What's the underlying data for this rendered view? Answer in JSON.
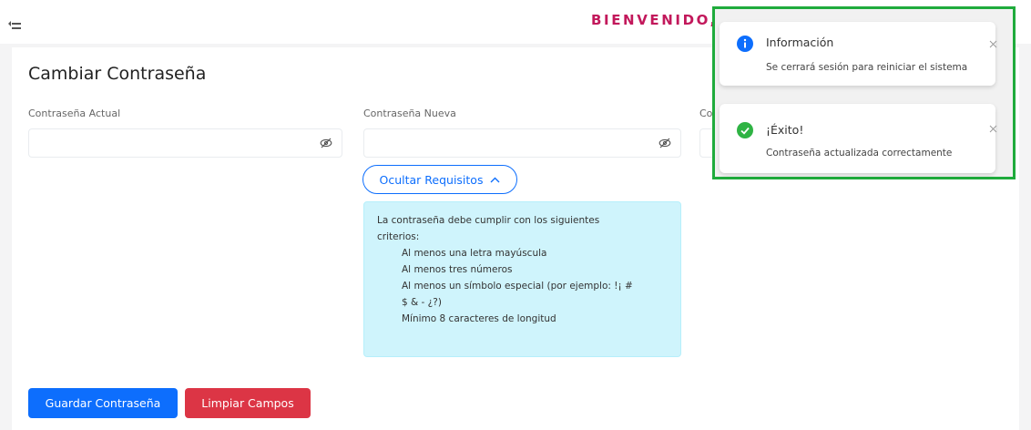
{
  "header": {
    "welcome_text": "BIENVENIDO, C",
    "colors": {
      "welcome": "#c2185b",
      "logout_button": "#e53950"
    },
    "icons": {
      "menu": "menu-collapse-icon"
    }
  },
  "page": {
    "title": "Cambiar Contraseña",
    "fields": [
      {
        "label": "Contraseña Actual",
        "value": "",
        "icon": "eye-slash-icon"
      },
      {
        "label": "Contraseña Nueva",
        "value": "",
        "icon": "eye-slash-icon"
      },
      {
        "label": "Co",
        "value": "",
        "icon": "eye-slash-icon"
      }
    ],
    "requirements_toggle": {
      "label": "Ocultar Requisitos",
      "icon": "chevron-up-icon"
    },
    "requirements": {
      "intro_line1": "La contraseña debe cumplir con los siguientes",
      "intro_line2": "criterios:",
      "items": [
        "Al menos una letra mayúscula",
        "Al menos tres números",
        "Al menos un símbolo especial (por ejemplo: !¡ #",
        "$ & - ¿?)",
        "Mínimo 8 caracteres de longitud"
      ]
    },
    "actions": {
      "save_label": "Guardar Contraseña",
      "clear_label": "Limpiar Campos"
    },
    "colors": {
      "primary": "#0d6efd",
      "danger": "#dc3545",
      "info_bg": "#cff4fc"
    }
  },
  "toasts": [
    {
      "type": "info",
      "icon": "info-icon",
      "title": "Información",
      "message": "Se cerrará sesión para reiniciar el sistema",
      "color": "#0d6efd"
    },
    {
      "type": "success",
      "icon": "check-circle-icon",
      "title": "¡Éxito!",
      "message": "Contraseña actualizada correctamente",
      "color": "#2fb344"
    }
  ],
  "highlight": {
    "color": "#1fab3c"
  }
}
